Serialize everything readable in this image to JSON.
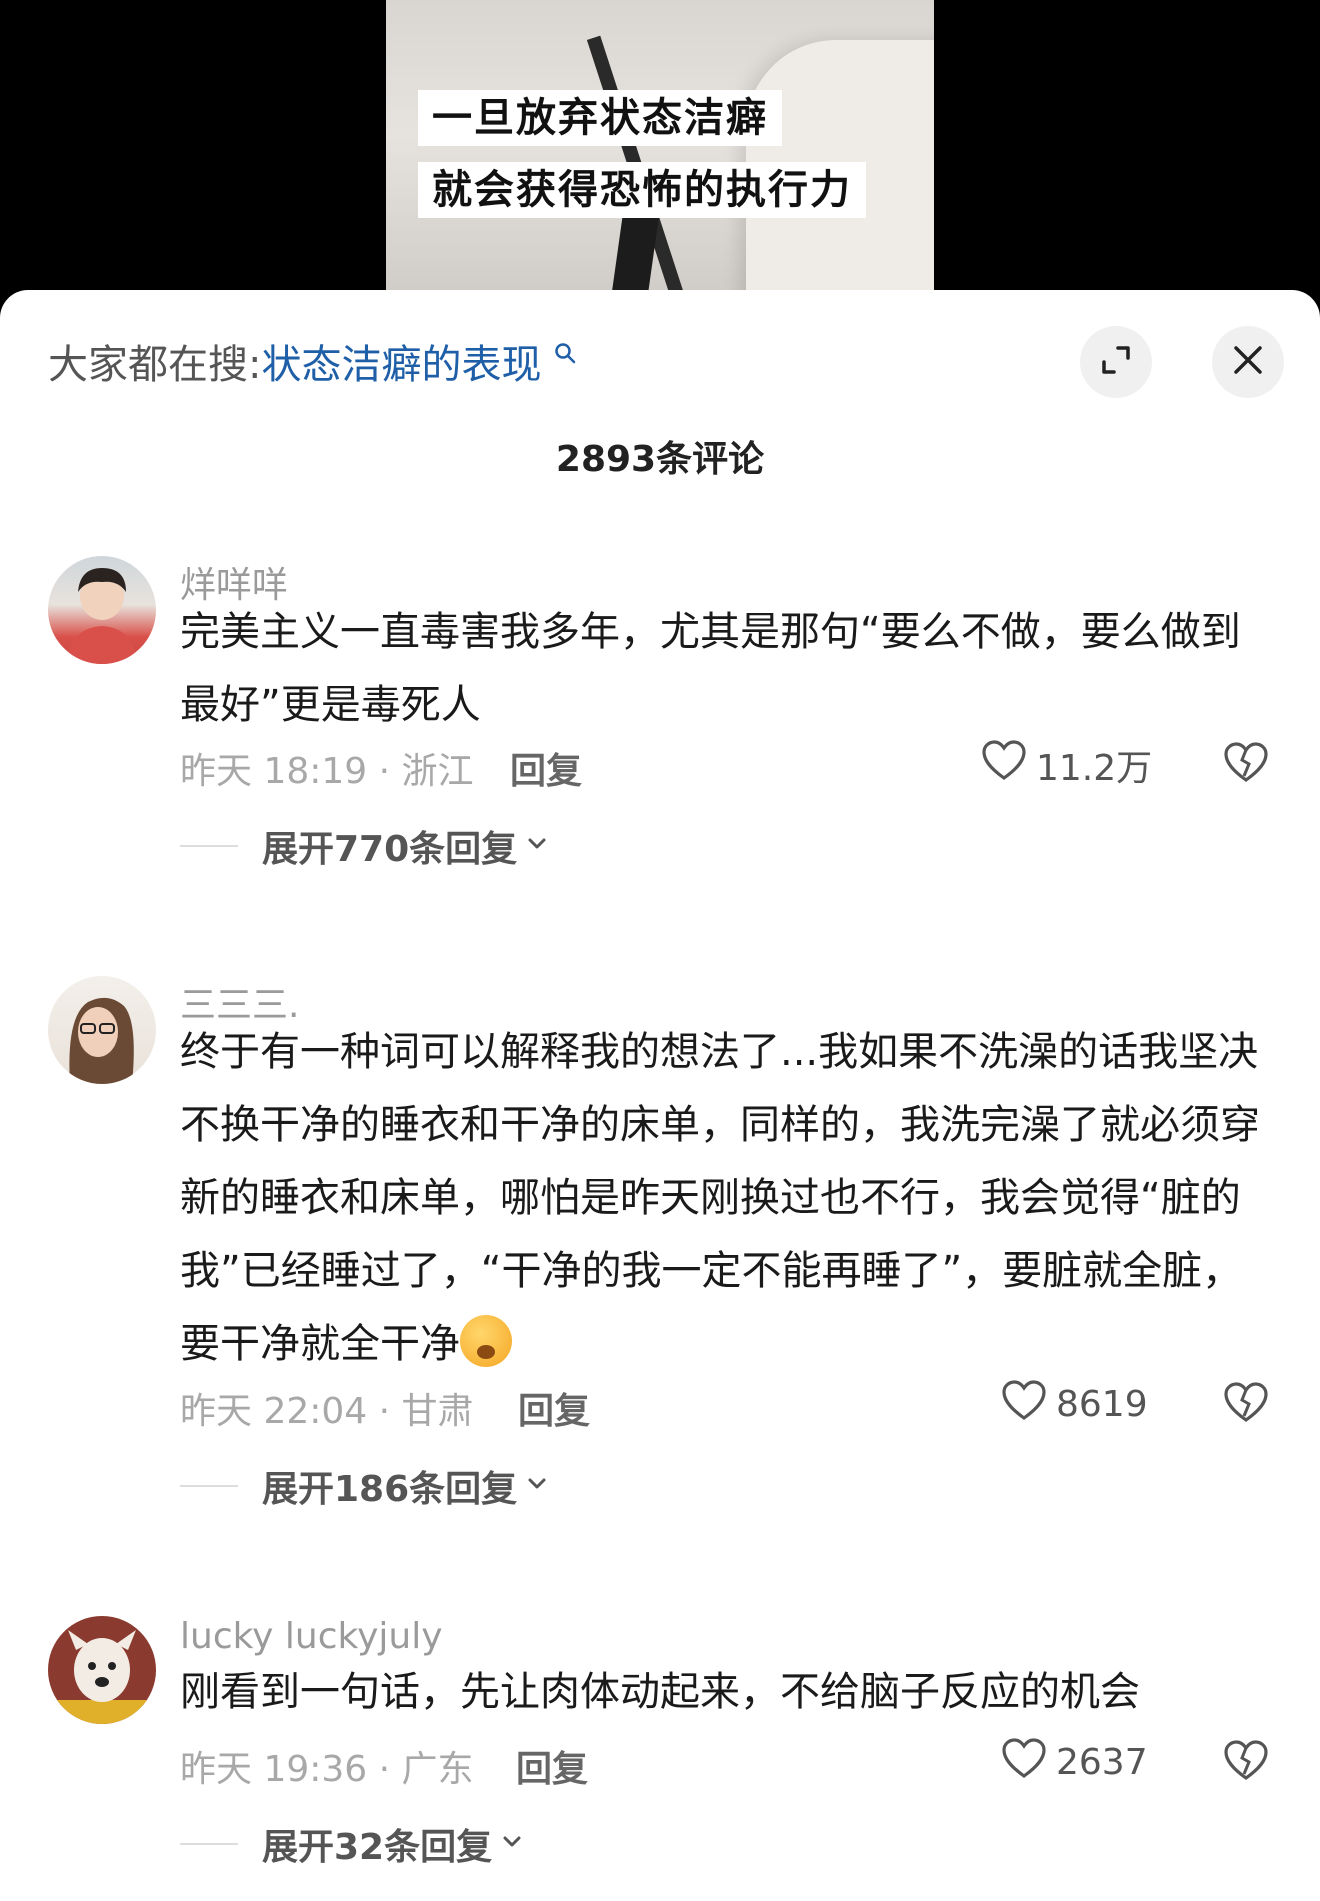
{
  "video": {
    "caption_line1": "一旦放弃状态洁癖",
    "caption_line2": "就会获得恐怖的执行力"
  },
  "header": {
    "search_prefix": "大家都在搜:",
    "search_keyword": "状态洁癖的表现",
    "comment_count": "2893条评论"
  },
  "comments": [
    {
      "username": "烊咩咩",
      "text": "完美主义一直毒害我多年，尤其是那句“要么不做，要么做到最好”更是毒死人",
      "meta": "昨天 18:19 · 浙江",
      "reply_label": "回复",
      "likes": "11.2万",
      "expand_label": "展开770条回复"
    },
    {
      "username": "三三三.",
      "text": "终于有一种词可以解释我的想法了...我如果不洗澡的话我坚决不换干净的睡衣和干净的床单，同样的，我洗完澡了就必须穿新的睡衣和床单，哪怕是昨天刚换过也不行，我会觉得“脏的我”已经睡过了，“干净的我一定不能再睡了”，要脏就全脏，要干净就全干净",
      "meta": "昨天 22:04 · 甘肃",
      "reply_label": "回复",
      "likes": "8619",
      "expand_label": "展开186条回复"
    },
    {
      "username": "lucky luckyjuly",
      "text": "刚看到一句话，先让肉体动起来，不给脑子反应的机会",
      "meta": "昨天 19:36 · 广东",
      "reply_label": "回复",
      "likes": "2637",
      "expand_label": "展开32条回复"
    }
  ],
  "colors": {
    "keyword": "#1f5fa8",
    "sheet_bg": "#ffffff",
    "meta_text": "#a8a8a8"
  },
  "icons": [
    "search-icon",
    "expand-icon",
    "close-icon",
    "heart-icon",
    "broken-heart-icon",
    "chevron-down-icon"
  ]
}
